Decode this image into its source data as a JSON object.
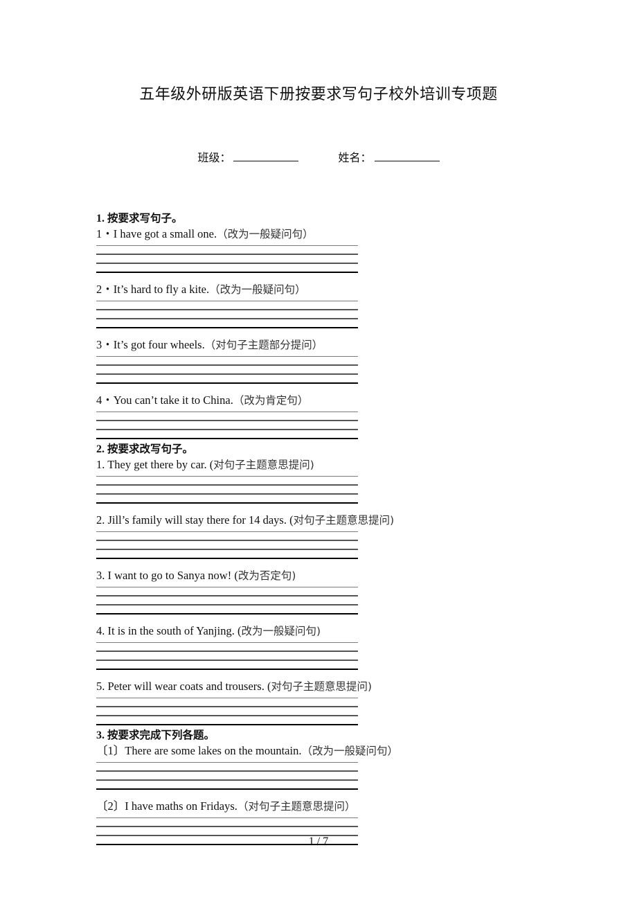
{
  "document": {
    "title": "五年级外研版英语下册按要求写句子校外培训专项题",
    "info_fields": [
      {
        "label": "班级："
      },
      {
        "label": "姓名："
      }
    ],
    "sections": [
      {
        "number": "1.",
        "heading": "按要求写句子。",
        "questions": [
          {
            "prefix": "1・",
            "en": "I have got a small one.",
            "cn": "（改为一般疑问句）"
          },
          {
            "prefix": "2・",
            "en": "It’s hard to fly a kite.",
            "cn": "（改为一般疑问句）"
          },
          {
            "prefix": "3・",
            "en": "It’s got four wheels.",
            "cn": "（对句子主题部分提问）"
          },
          {
            "prefix": "4・",
            "en": "You can’t take it to China.",
            "cn": "（改为肯定句）"
          }
        ]
      },
      {
        "number": "2.",
        "heading": "按要求改写句子。",
        "questions": [
          {
            "prefix": "1. ",
            "en": "They get there by car. (",
            "cn": "对句子主题意思提问)"
          },
          {
            "prefix": "2. ",
            "en": "Jill’s family will stay there for 14 days. (",
            "cn": "对句子主题意思提问)"
          },
          {
            "prefix": "3. ",
            "en": "I want to go to Sanya now! (",
            "cn": "改为否定句)"
          },
          {
            "prefix": "4. ",
            "en": "It is in the south of Yanjing. (",
            "cn": "改为一般疑问句)"
          },
          {
            "prefix": "5. ",
            "en": "Peter will wear coats and trousers. (",
            "cn": "对句子主题意思提问)"
          }
        ]
      },
      {
        "number": "3.",
        "heading": "按要求完成下列各题。",
        "questions": [
          {
            "prefix": "〔1〕",
            "en": "There are some lakes on the mountain.",
            "cn": "（改为一般疑问句）"
          },
          {
            "prefix": "〔2〕",
            "en": "I have maths on Fridays.",
            "cn": "（对句子主题意思提问）"
          }
        ]
      }
    ],
    "page_number": "1 / 7"
  }
}
